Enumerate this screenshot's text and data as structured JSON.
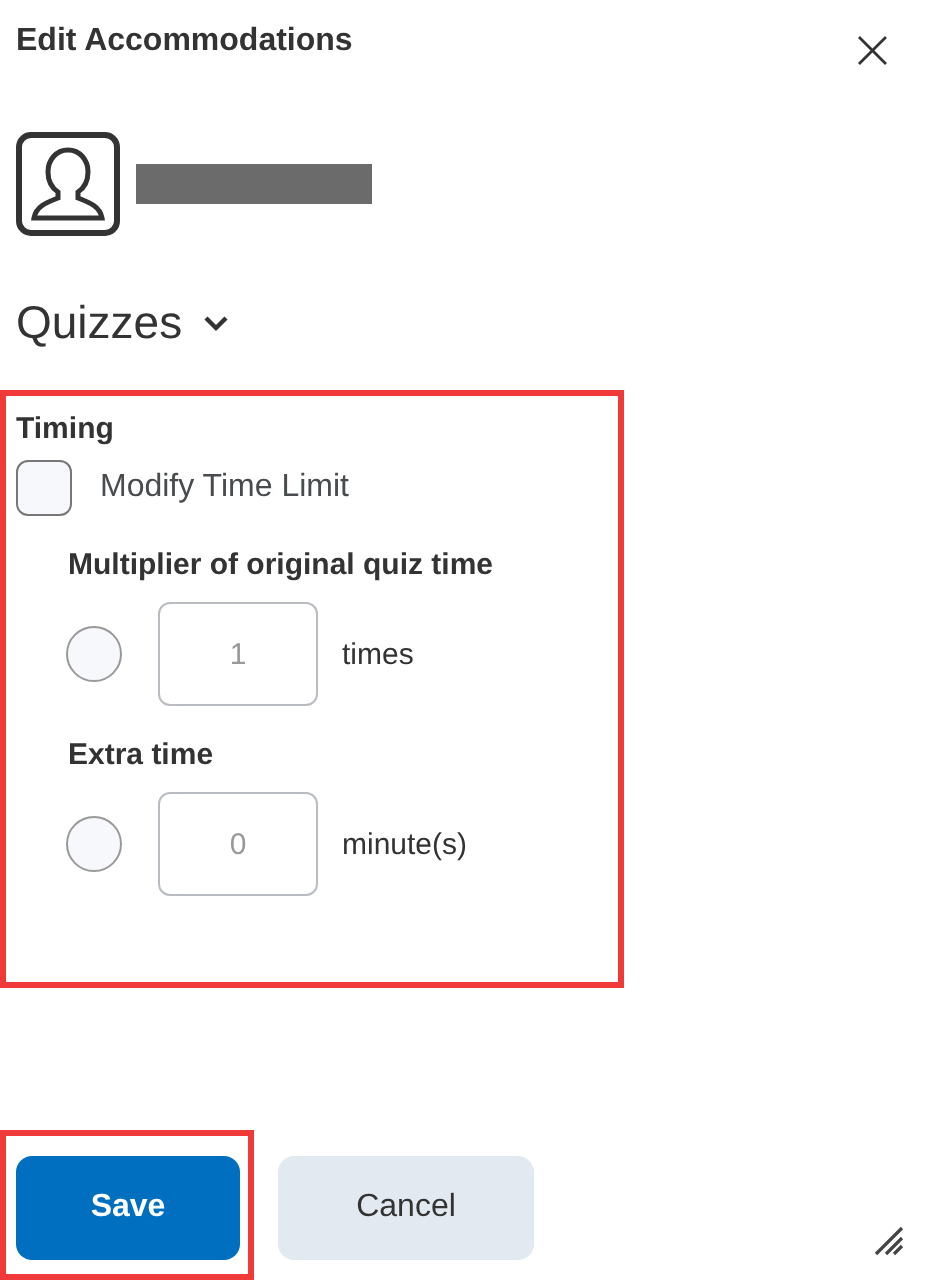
{
  "dialog": {
    "title": "Edit Accommodations",
    "close": "×"
  },
  "section": {
    "title": "Quizzes",
    "expanded": true
  },
  "timing": {
    "heading": "Timing",
    "checkbox": {
      "label": "Modify Time Limit",
      "checked": false
    },
    "options": [
      {
        "label": "Multiplier of original quiz time",
        "selected": false,
        "value": "1",
        "unit": "times",
        "disabled": true
      },
      {
        "label": "Extra time",
        "selected": false,
        "value": "0",
        "unit": "minute(s)",
        "disabled": true
      }
    ]
  },
  "buttons": [
    {
      "label": "Save",
      "kind": "primary"
    },
    {
      "label": "Cancel",
      "kind": "secondary"
    }
  ]
}
